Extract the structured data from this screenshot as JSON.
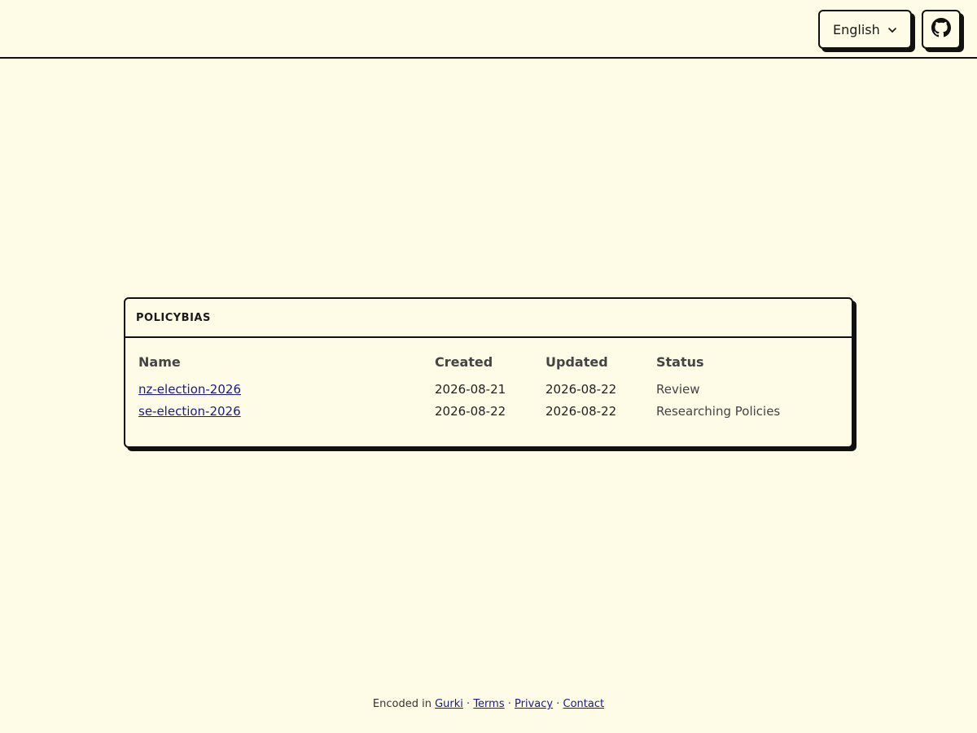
{
  "header": {
    "language_label": "English",
    "language_icon": "chevron-down-icon",
    "github_icon": "github-icon"
  },
  "card": {
    "title": "POLICYBIAS",
    "columns": [
      "Name",
      "Created",
      "Updated",
      "Status"
    ],
    "rows": [
      {
        "name": "nz-election-2026",
        "created": "2026-08-21",
        "updated": "2026-08-22",
        "status": "Review"
      },
      {
        "name": "se-election-2026",
        "created": "2026-08-22",
        "updated": "2026-08-22",
        "status": "Researching Policies"
      }
    ]
  },
  "footer": {
    "prefix": "Encoded in",
    "gurki": "Gurki",
    "sep": "·",
    "terms": "Terms",
    "privacy": "Privacy",
    "contact": "Contact"
  }
}
